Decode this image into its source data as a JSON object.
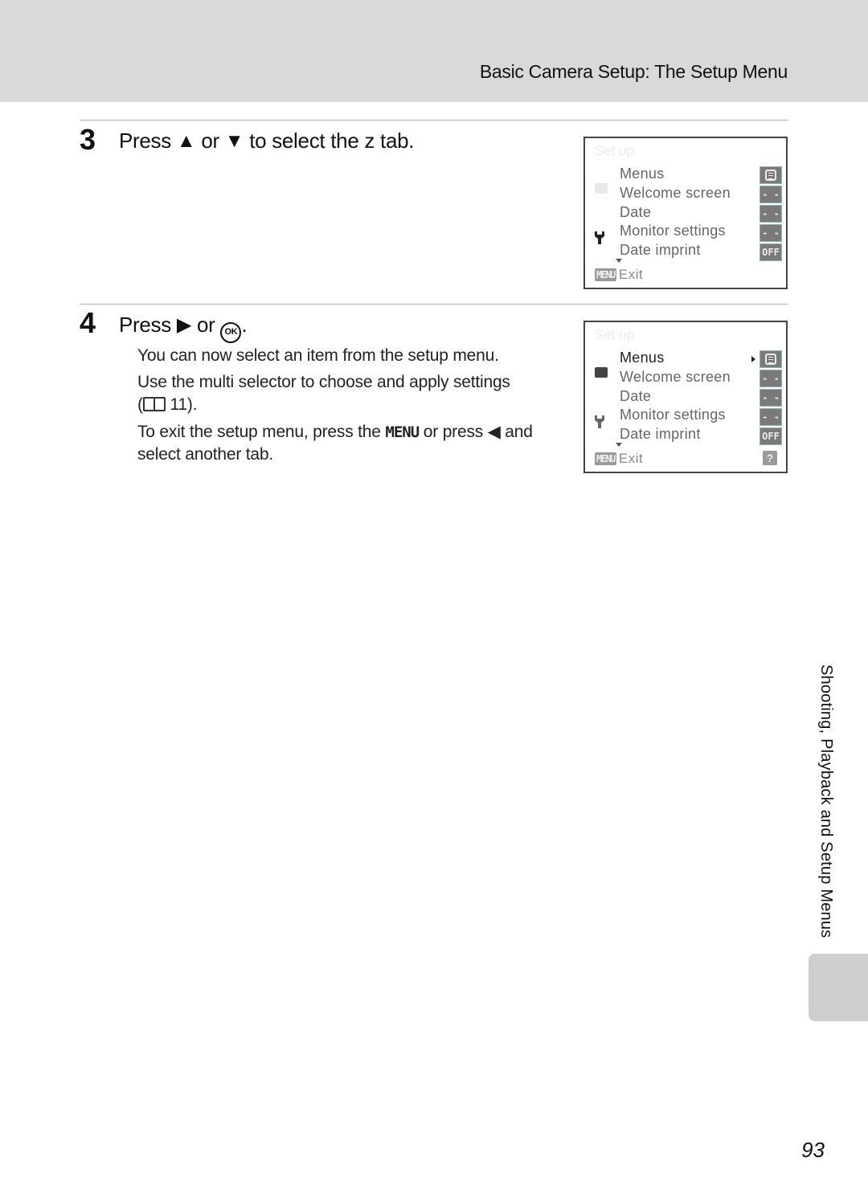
{
  "header": {
    "title": "Basic Camera Setup: The Setup Menu"
  },
  "steps": [
    {
      "number": "3",
      "title_parts": {
        "press": "Press",
        "up_glyph": "▲",
        "or": "or",
        "down_glyph": "▼",
        "rest": "to select the z  tab."
      }
    },
    {
      "number": "4",
      "title_parts": {
        "press": "Press",
        "right_glyph": "▶",
        "or": "or",
        "ok_glyph": "OK",
        "end": "."
      },
      "body": {
        "p1": "You can now select an item from the setup menu.",
        "p2a": "Use the multi selector to choose and apply settings",
        "p2b_open": "(",
        "p2b_ref": "11).",
        "p3a": "To exit the setup menu, press the",
        "p3_menu": "MENU",
        "p3b": "or press",
        "p3_left_glyph": "◀",
        "p3c": "and",
        "p3d": "select another tab."
      }
    }
  ],
  "screens": [
    {
      "title": "Set up",
      "items": [
        "Menus",
        "Welcome screen",
        "Date",
        "Monitor settings",
        "Date imprint"
      ],
      "values": [
        "list-icon",
        "- -",
        "- -",
        "- -",
        "OFF"
      ],
      "menu_button": "MENU",
      "exit_label": "Exit",
      "tab_icons": [
        "camera-icon",
        "wrench-icon"
      ]
    },
    {
      "title": "Set up",
      "items": [
        "Menus",
        "Welcome screen",
        "Date",
        "Monitor settings",
        "Date imprint"
      ],
      "values": [
        "list-icon",
        "- -",
        "- -",
        "- -",
        "OFF"
      ],
      "menu_button": "MENU",
      "exit_label": "Exit",
      "help_label": "?",
      "tab_icons": [
        "camera-icon",
        "wrench-icon"
      ]
    }
  ],
  "side": {
    "section_label": "Shooting, Playback and Setup Menus"
  },
  "page_number": "93"
}
